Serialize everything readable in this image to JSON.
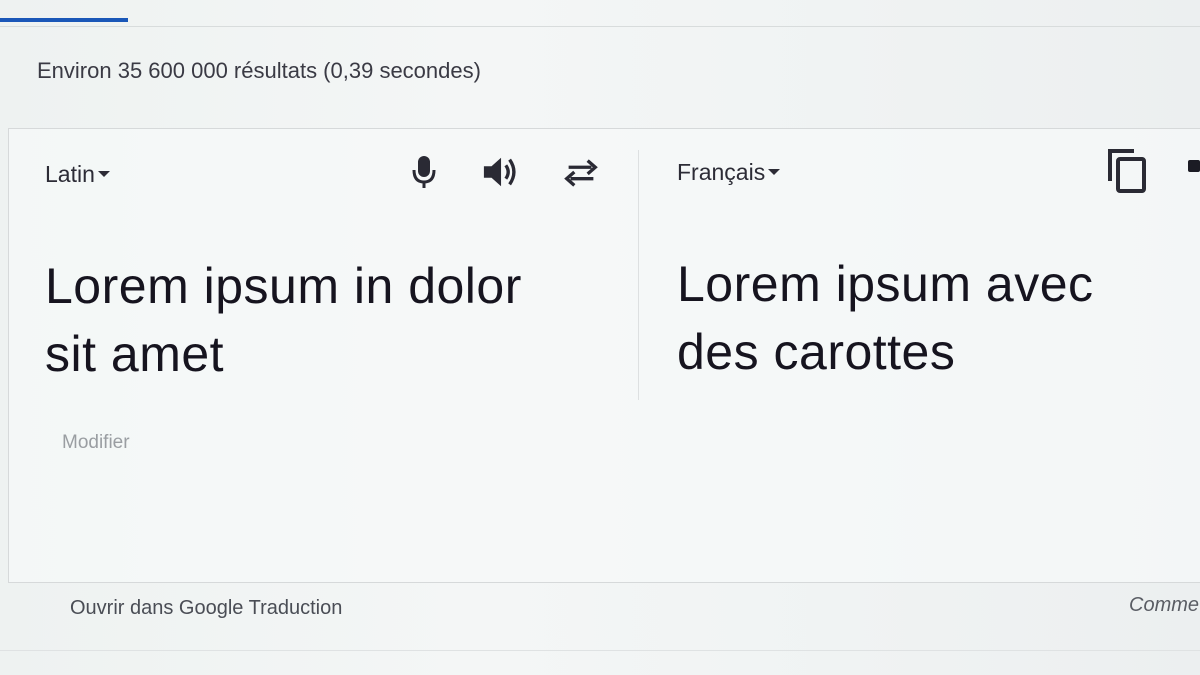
{
  "search": {
    "result_stats": "Environ 35 600 000 résultats (0,39 secondes)"
  },
  "translator": {
    "source": {
      "language": "Latin",
      "text_line1": "Lorem ipsum in dolor",
      "text_line2": "sit amet",
      "edit_label": "Modifier"
    },
    "target": {
      "language": "Français",
      "text_line1": "Lorem ipsum avec",
      "text_line2": "des carottes"
    },
    "icons": {
      "microphone": "microphone-icon",
      "speaker": "speaker-icon",
      "swap": "swap-languages-icon",
      "copy": "copy-icon"
    }
  },
  "footer": {
    "open_link": "Ouvrir dans Google Traduction",
    "feedback": "Comme"
  },
  "colors": {
    "accent": "#1a57b8",
    "text": "#16141f",
    "muted": "#9a9ea2"
  }
}
